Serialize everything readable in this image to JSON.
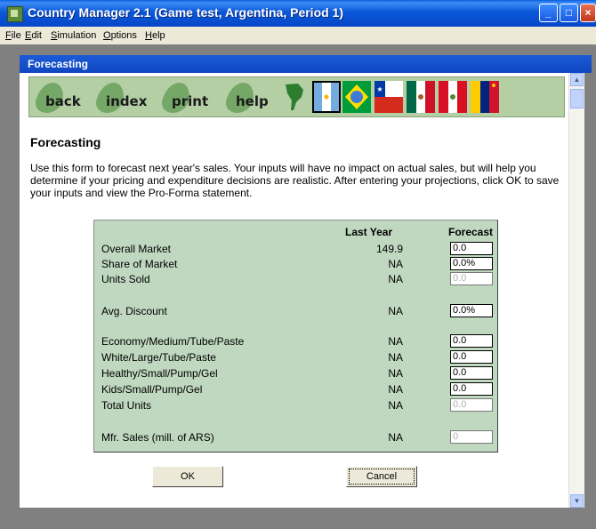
{
  "window": {
    "title": "Country Manager 2.1 (Game test, Argentina, Period 1)"
  },
  "menu": [
    "File",
    "Edit",
    "Simulation",
    "Options",
    "Help"
  ],
  "panel": {
    "title": "Forecasting"
  },
  "nav": {
    "buttons": [
      "back",
      "index",
      "print",
      "help"
    ]
  },
  "flags": [
    "south-america-map-icon",
    "argentina-flag-icon",
    "brazil-flag-icon",
    "chile-flag-icon",
    "mexico-flag-icon",
    "peru-flag-icon",
    "venezuela-flag-icon"
  ],
  "page": {
    "heading": "Forecasting",
    "intro": "Use this form to forecast next year's sales. Your inputs will have no impact on actual sales, but will help you determine if your pricing and expenditure decisions are realistic. After entering your projections, click OK to save your inputs and view the Pro-Forma statement."
  },
  "table": {
    "col_last_year": "Last Year",
    "col_forecast": "Forecast",
    "rows": [
      {
        "label": "Overall Market",
        "last_year": "149.9",
        "forecast": "0.0",
        "editable": true
      },
      {
        "label": "Share of Market",
        "last_year": "NA",
        "forecast": "0.0%",
        "editable": true
      },
      {
        "label": "Units Sold",
        "last_year": "NA",
        "forecast": "0.0",
        "editable": false
      },
      {
        "label": "Avg. Discount",
        "last_year": "NA",
        "forecast": "0.0%",
        "editable": true
      },
      {
        "label": "Economy/Medium/Tube/Paste",
        "last_year": "NA",
        "forecast": "0.0",
        "editable": true
      },
      {
        "label": "White/Large/Tube/Paste",
        "last_year": "NA",
        "forecast": "0.0",
        "editable": true
      },
      {
        "label": "Healthy/Small/Pump/Gel",
        "last_year": "NA",
        "forecast": "0.0",
        "editable": true
      },
      {
        "label": "Kids/Small/Pump/Gel",
        "last_year": "NA",
        "forecast": "0.0",
        "editable": true
      },
      {
        "label": "Total Units",
        "last_year": "NA",
        "forecast": "0.0",
        "editable": false
      },
      {
        "label": "Mfr. Sales (mill. of ARS)",
        "last_year": "NA",
        "forecast": "0",
        "editable": false
      }
    ]
  },
  "buttons": {
    "ok": "OK",
    "cancel": "Cancel"
  },
  "colors": {
    "titlebar": "#0a58d8",
    "grid_bg": "#c0d8c0",
    "nav_bg": "#b5cfa5"
  }
}
